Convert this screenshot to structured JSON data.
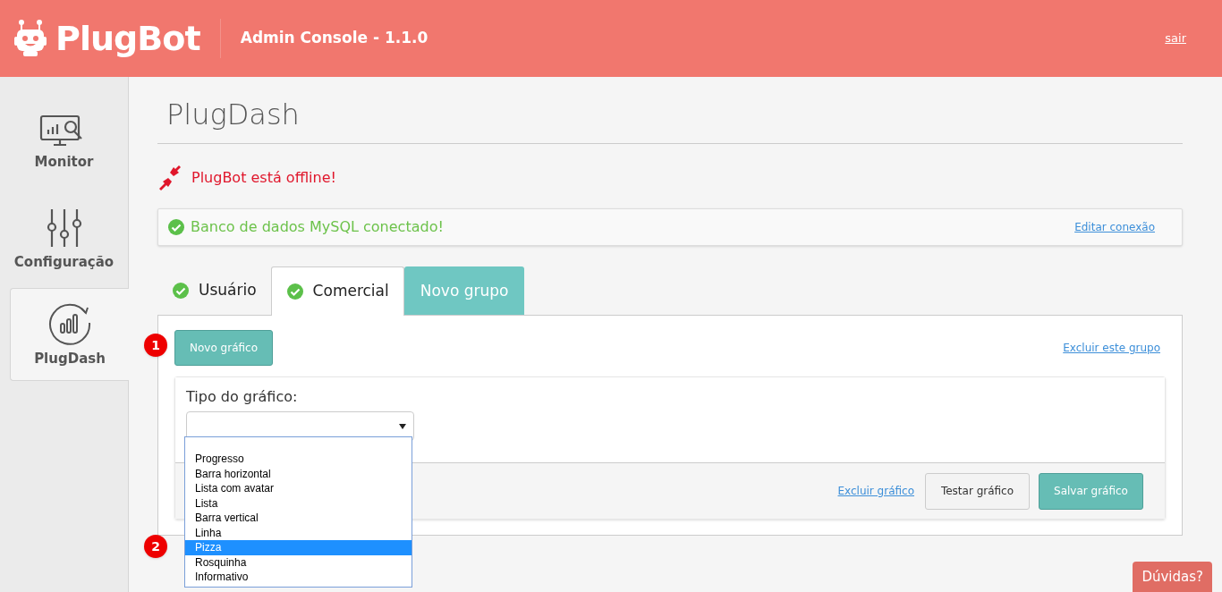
{
  "header": {
    "logo": "PlugBot",
    "subtitle": "Admin Console - 1.1.0",
    "logout": "sair"
  },
  "sidebar": {
    "items": [
      {
        "label": "Monitor",
        "kind": "monitor",
        "selected": false
      },
      {
        "label": "Configuração",
        "kind": "sliders",
        "selected": false
      },
      {
        "label": "PlugDash",
        "kind": "dash",
        "selected": true
      }
    ]
  },
  "page_title": "PlugDash",
  "bot_status": {
    "text": "PlugBot está offline!",
    "online": false
  },
  "db_status": {
    "text": "Banco de dados MySQL conectado!",
    "connected": true,
    "link": "Editar conexão"
  },
  "tabs": [
    {
      "label": "Usuário",
      "kind": "group",
      "checked": true,
      "selected": false
    },
    {
      "label": "Comercial",
      "kind": "group",
      "checked": true,
      "selected": true
    },
    {
      "label": "Novo grupo",
      "kind": "add",
      "selected": false
    }
  ],
  "new_chart_button": "Novo gráfico",
  "delete_group_link": "Excluir este grupo",
  "chart_form": {
    "type_label": "Tipo do gráfico:",
    "options": [
      {
        "label": "Progresso",
        "selected": false
      },
      {
        "label": "Barra horizontal",
        "selected": false
      },
      {
        "label": "Lista com avatar",
        "selected": false
      },
      {
        "label": "Lista",
        "selected": false
      },
      {
        "label": "Barra vertical",
        "selected": false
      },
      {
        "label": "Linha",
        "selected": false
      },
      {
        "label": "Pizza",
        "selected": true
      },
      {
        "label": "Rosquinha",
        "selected": false
      },
      {
        "label": "Informativo",
        "selected": false
      }
    ],
    "delete_link": "Excluir gráfico",
    "test_button": "Testar gráfico",
    "save_button": "Salvar gráfico"
  },
  "annotations": [
    "1",
    "2"
  ],
  "help_button": "Dúvidas?"
}
